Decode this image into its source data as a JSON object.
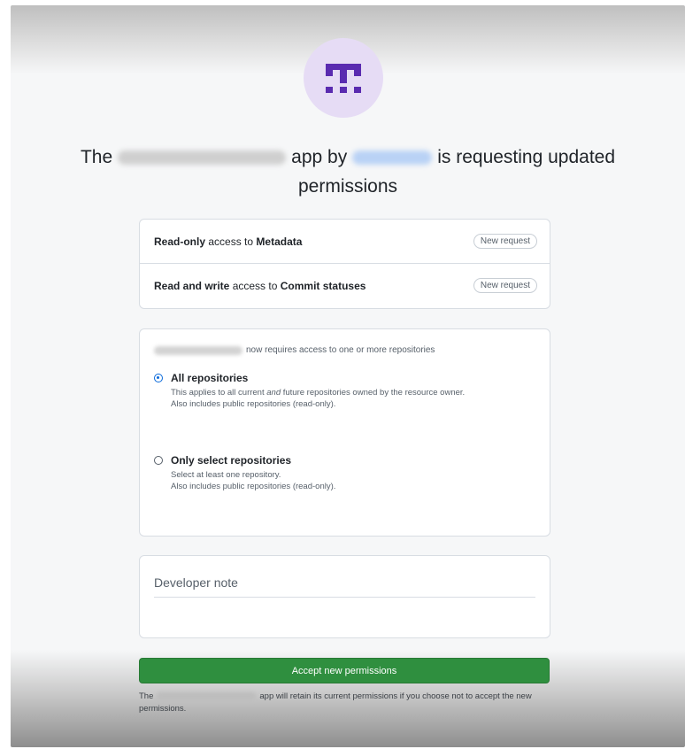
{
  "header": {
    "logo_icon": "github-app-logo-icon",
    "title_prefix": "The",
    "title_mid": "app by",
    "title_suffix": "is requesting updated",
    "title_line2": "permissions"
  },
  "permissions": [
    {
      "level": "Read-only",
      "text": "access to",
      "resource": "Metadata",
      "badge": "New request"
    },
    {
      "level": "Read and write",
      "text": "access to",
      "resource": "Commit statuses",
      "badge": "New request"
    }
  ],
  "repositories": {
    "heading_suffix": "now requires access to one or more repositories",
    "options": [
      {
        "title": "All repositories",
        "desc_prefix": "This applies to all current",
        "desc_em": "and",
        "desc_suffix": "future repositories owned by the resource owner.",
        "desc_line2": "Also includes public repositories (read-only).",
        "selected": true
      },
      {
        "title": "Only select repositories",
        "desc_line1": "Select at least one repository.",
        "desc_line2": "Also includes public repositories (read-only).",
        "selected": false
      }
    ]
  },
  "developer_note": {
    "label": "Developer note"
  },
  "accept_button": {
    "label": "Accept new permissions",
    "color": "#2f8f3f"
  },
  "footer": {
    "prefix": "The",
    "suffix": "app will retain its current permissions if you choose not to accept the new permissions."
  }
}
